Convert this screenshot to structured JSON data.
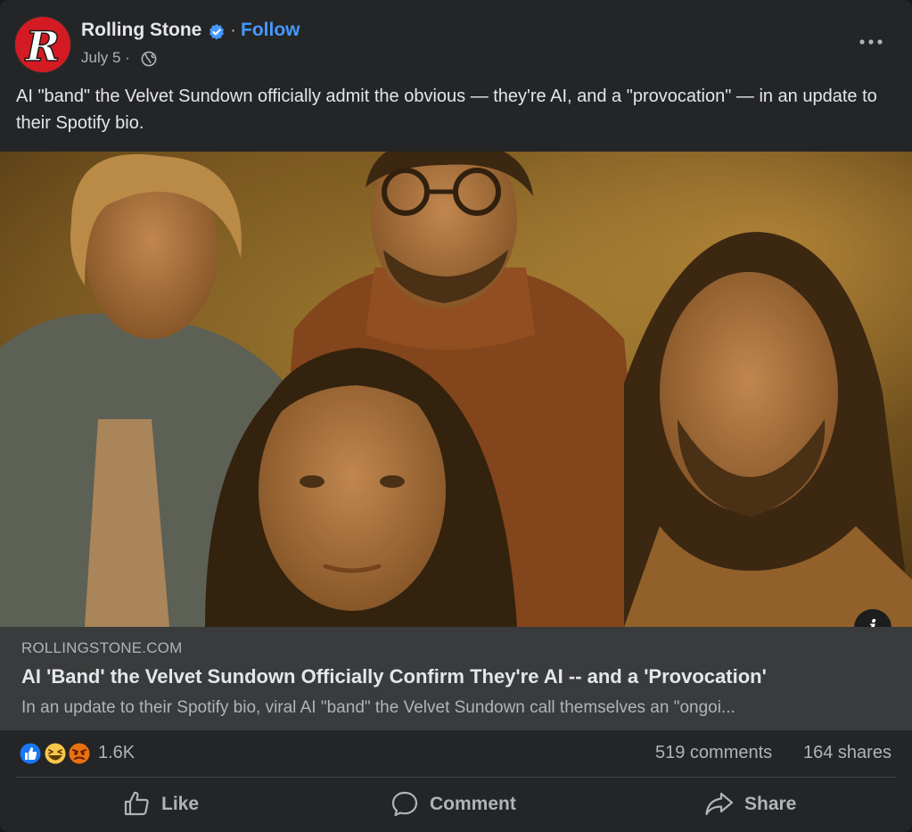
{
  "post": {
    "page_name": "Rolling Stone",
    "separator": "·",
    "follow_label": "Follow",
    "date": "July 5 ·",
    "caption": "AI \"band\" the Velvet Sundown officially admit the obvious — they're AI, and a \"provocation\" — in an update to their Spotify bio."
  },
  "avatar": {
    "letter": "R"
  },
  "link_preview": {
    "domain": "ROLLINGSTONE.COM",
    "title": "AI 'Band' the Velvet Sundown Officially Confirm They're AI -- and a 'Provocation'",
    "description": "In an update to their Spotify bio, viral AI \"band\" the Velvet Sundown call themselves an \"ongoi..."
  },
  "stats": {
    "reactions_count": "1.6K",
    "comments": "519 comments",
    "shares": "164 shares",
    "reaction_icons": [
      "like-icon",
      "haha-icon",
      "angry-icon"
    ]
  },
  "actions": {
    "like": "Like",
    "comment": "Comment",
    "share": "Share"
  },
  "colors": {
    "background": "#242526",
    "link_accent": "#4599ff",
    "verified": "#4599ff",
    "preview_bg": "#3a3b3c"
  },
  "icons": {
    "verified": "verified-badge-icon",
    "privacy": "globe-icon",
    "more": "more-options-icon",
    "info": "info-icon"
  }
}
